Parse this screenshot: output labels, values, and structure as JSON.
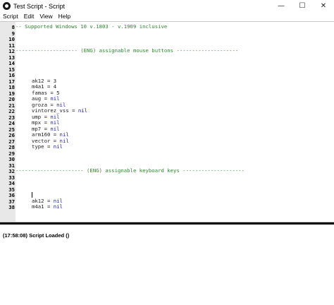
{
  "window": {
    "title": "Test Script - Script",
    "minimize_glyph": "—",
    "maximize_glyph": "☐",
    "close_glyph": "✕"
  },
  "menu": [
    "Script",
    "Edit",
    "View",
    "Help"
  ],
  "editor": {
    "lines": [
      {
        "num": "8",
        "text": "-- Supported Windows 10 v.1803 - v.1909 inclusive",
        "kind": "comment"
      },
      {
        "num": "9",
        "text": "",
        "kind": "blank"
      },
      {
        "num": "10",
        "text": "",
        "kind": "blank"
      },
      {
        "num": "11",
        "text": "",
        "kind": "blank"
      },
      {
        "num": "12",
        "text": "-------------------- (ENG) assignable mouse buttons --------------------",
        "kind": "comment"
      },
      {
        "num": "13",
        "text": "",
        "kind": "blank"
      },
      {
        "num": "14",
        "text": "",
        "kind": "blank"
      },
      {
        "num": "15",
        "text": "",
        "kind": "blank"
      },
      {
        "num": "16",
        "text": "",
        "kind": "blank"
      },
      {
        "num": "17",
        "text": "ak12 = 3",
        "kind": "assign",
        "name": "ak12",
        "value": "3"
      },
      {
        "num": "18",
        "text": "m4a1 = 4",
        "kind": "assign",
        "name": "m4a1",
        "value": "4"
      },
      {
        "num": "19",
        "text": "famas = 5",
        "kind": "assign",
        "name": "famas",
        "value": "5"
      },
      {
        "num": "20",
        "text": "aug = nil",
        "kind": "assign",
        "name": "aug",
        "value": "nil"
      },
      {
        "num": "21",
        "text": "groza = nil",
        "kind": "assign",
        "name": "groza",
        "value": "nil"
      },
      {
        "num": "22",
        "text": "vintorez_vss = nil",
        "kind": "assign",
        "name": "vintorez_vss",
        "value": "nil"
      },
      {
        "num": "23",
        "text": "ump = nil",
        "kind": "assign",
        "name": "ump",
        "value": "nil"
      },
      {
        "num": "24",
        "text": "mpx = nil",
        "kind": "assign",
        "name": "mpx",
        "value": "nil"
      },
      {
        "num": "25",
        "text": "mp7 = nil",
        "kind": "assign",
        "name": "mp7",
        "value": "nil"
      },
      {
        "num": "26",
        "text": "arm160 = nil",
        "kind": "assign",
        "name": "arm160",
        "value": "nil"
      },
      {
        "num": "27",
        "text": "vector = nil",
        "kind": "assign",
        "name": "vector",
        "value": "nil"
      },
      {
        "num": "28",
        "text": "type = nil",
        "kind": "assign",
        "name": "type",
        "value": "nil"
      },
      {
        "num": "29",
        "text": "",
        "kind": "blank"
      },
      {
        "num": "30",
        "text": "",
        "kind": "blank"
      },
      {
        "num": "31",
        "text": "",
        "kind": "blank"
      },
      {
        "num": "32",
        "text": "---------------------- (ENG) assignable keyboard keys --------------------",
        "kind": "comment"
      },
      {
        "num": "33",
        "text": "",
        "kind": "blank"
      },
      {
        "num": "34",
        "text": "",
        "kind": "blank"
      },
      {
        "num": "35",
        "text": "",
        "kind": "blank"
      },
      {
        "num": "36",
        "text": "",
        "kind": "blank"
      },
      {
        "num": "37",
        "text": "ak12 = nil",
        "kind": "assign",
        "name": "ak12",
        "value": "nil"
      },
      {
        "num": "38",
        "text": "m4a1 = nil",
        "kind": "assign",
        "name": "m4a1",
        "value": "nil"
      }
    ],
    "caret_line": "36"
  },
  "console": {
    "message": "(17:58:08) Script Loaded ()"
  },
  "colors": {
    "comment": "#2a8a2a",
    "keyword_nil": "#1a1ab8",
    "gutter_bg": "#e8e8e8",
    "divider": "#000000"
  }
}
